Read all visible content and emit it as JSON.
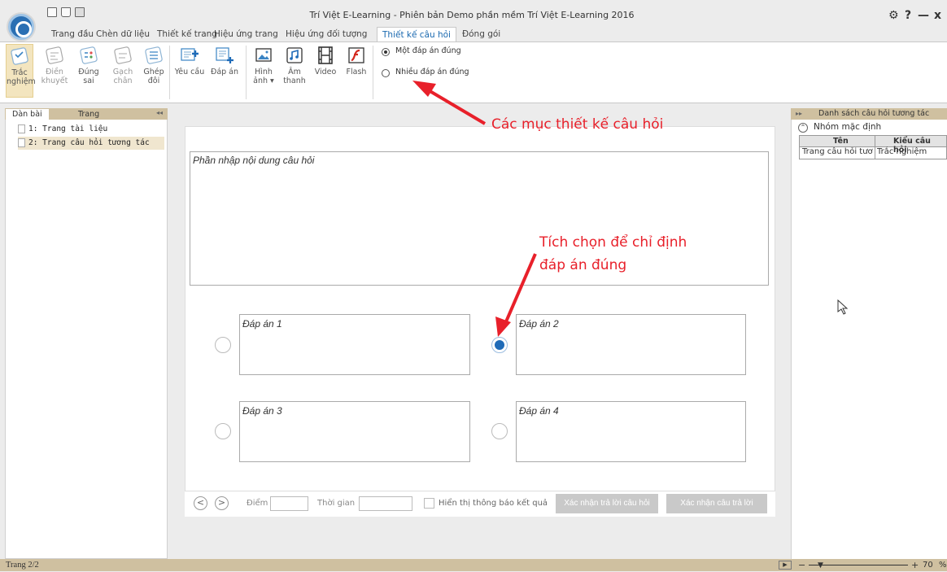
{
  "window": {
    "title": "Trí Việt E-Learning - Phiên bản Demo phần mềm Trí Việt E-Learning 2016",
    "controls": {
      "settings": "⚙",
      "help": "?",
      "minimize": "—",
      "close": "x"
    }
  },
  "quick_access": [
    "new-file-icon",
    "open-folder-icon",
    "save-icon"
  ],
  "menu_tabs": [
    "Trang đầu",
    "Chèn dữ liệu",
    "Thiết kế trang",
    "Hiệu ứng trang",
    "Hiệu ứng đối tượng",
    "Thiết kế câu hỏi",
    "Đóng gói"
  ],
  "active_tab": "Thiết kế câu hỏi",
  "ribbon": {
    "question_types": [
      {
        "label1": "Trắc",
        "label2": "nghiệm",
        "icon": "multiple-choice-icon",
        "selected": true
      },
      {
        "label1": "Điền",
        "label2": "khuyết",
        "icon": "fill-blank-icon",
        "selected": false
      },
      {
        "label1": "Đúng",
        "label2": "sai",
        "icon": "true-false-icon",
        "selected": false
      },
      {
        "label1": "Gạch",
        "label2": "chân",
        "icon": "underline-icon",
        "selected": false
      },
      {
        "label1": "Ghép",
        "label2": "đôi",
        "icon": "matching-icon",
        "selected": false
      }
    ],
    "add_buttons": [
      {
        "label1": "Yêu cầu",
        "label2": "",
        "icon": "add-request-icon"
      },
      {
        "label1": "Đáp án",
        "label2": "",
        "icon": "add-answer-icon"
      }
    ],
    "media_buttons": [
      {
        "label1": "Hình",
        "label2": "ảnh ▾",
        "icon": "image-icon"
      },
      {
        "label1": "Âm",
        "label2": "thanh",
        "icon": "audio-icon"
      },
      {
        "label1": "Video",
        "label2": "",
        "icon": "video-icon"
      },
      {
        "label1": "Flash",
        "label2": "",
        "icon": "flash-icon"
      }
    ],
    "answer_modes": [
      {
        "label": "Một đáp án đúng",
        "selected": true
      },
      {
        "label": "Nhiều đáp án đúng",
        "selected": false
      }
    ]
  },
  "left_panel": {
    "tabs": [
      "Dàn bài",
      "Trang"
    ],
    "collapse": "◂◂",
    "pages": [
      "1: Trang tài liệu",
      "2: Trang câu hỏi tương tác"
    ]
  },
  "question": {
    "placeholder": "Phần nhập nội dung câu hỏi",
    "answers": [
      {
        "label": "Đáp án 1",
        "correct": false
      },
      {
        "label": "Đáp án 2",
        "correct": true
      },
      {
        "label": "Đáp án 3",
        "correct": false
      },
      {
        "label": "Đáp án 4",
        "correct": false
      }
    ]
  },
  "toolbar": {
    "prev": "<",
    "next": ">",
    "score_label": "Điểm",
    "time_label": "Thời gian",
    "show_result_label": "Hiển thị thông báo kết quả",
    "confirm_question": "Xác nhận trả lời câu hỏi",
    "confirm_answer": "Xác nhận câu trả lời"
  },
  "right_panel": {
    "expand": "▸▸",
    "title": "Danh sách câu hỏi tương tác",
    "group": "Nhóm mặc định",
    "columns": [
      "Tên",
      "Kiểu câu hỏi"
    ],
    "rows": [
      [
        "Trang câu hỏi tươ",
        "Trắc nghiệm"
      ]
    ]
  },
  "annotations": {
    "design_items": "Các mục thiết kế câu hỏi",
    "tick_line1": "Tích chọn để chỉ định",
    "tick_line2": "đáp án đúng"
  },
  "status": {
    "page": "Trang 2/2",
    "zoom": "70",
    "zoom_unit": "%",
    "zoom_out": "−",
    "zoom_in": "+"
  },
  "colors": {
    "accent": "#1b6ab0",
    "annotation": "#e8202a",
    "panel_header": "#cfc0a0"
  }
}
